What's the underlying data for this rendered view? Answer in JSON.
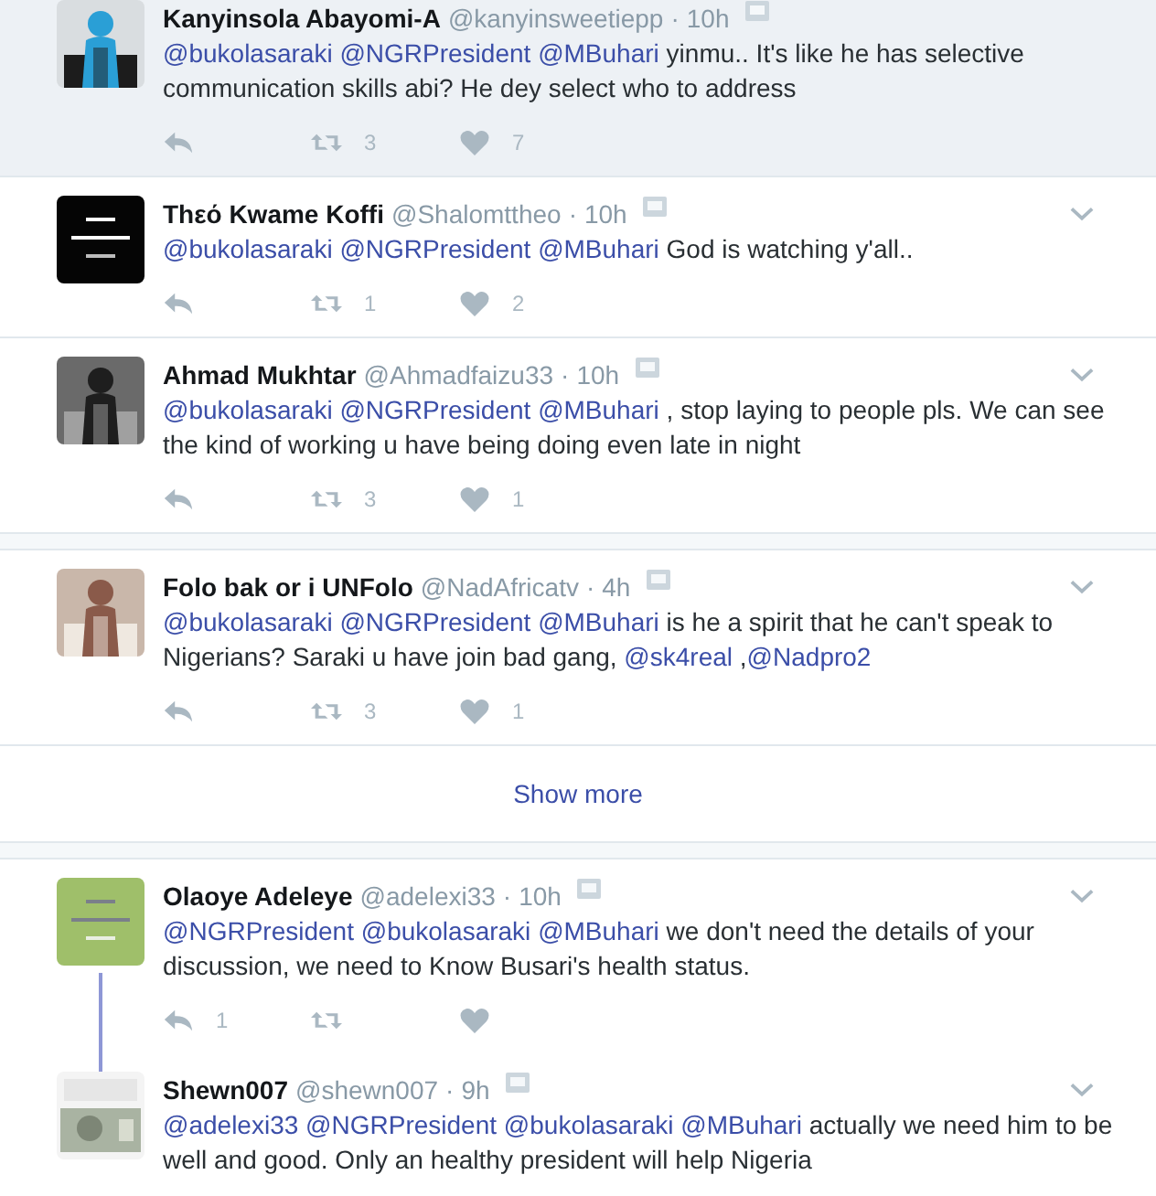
{
  "groups": [
    {
      "tweets": [
        {
          "name": "Kanyinsola Abayomi-A",
          "handle": "@kanyinsweetiepp",
          "dot": "·",
          "time": "10h",
          "cut_top": true,
          "highlighted": true,
          "thread": false,
          "actions": true,
          "text": [
            {
              "kind": "mention",
              "text": "@bukolasaraki"
            },
            {
              "kind": "mention",
              "text": "@NGRPresident"
            },
            {
              "kind": "mention",
              "text": "@MBuhari"
            },
            {
              "kind": "text",
              "text": "yinmu.. It's like he has selective communication skills abi? He dey select who to address"
            }
          ],
          "retweets": "3",
          "likes": "7"
        },
        {
          "name": "Thεό Kwame Koffi",
          "handle": "@Shalomttheo",
          "dot": "·",
          "time": "10h",
          "cut_top": false,
          "highlighted": false,
          "thread": false,
          "actions": true,
          "text": [
            {
              "kind": "mention",
              "text": "@bukolasaraki"
            },
            {
              "kind": "mention",
              "text": "@NGRPresident"
            },
            {
              "kind": "mention",
              "text": "@MBuhari"
            },
            {
              "kind": "text",
              "text": "God is watching y'all.."
            }
          ],
          "retweets": "1",
          "likes": "2"
        },
        {
          "name": "Ahmad Mukhtar",
          "handle": "@Ahmadfaizu33",
          "dot": "·",
          "time": "10h",
          "cut_top": false,
          "highlighted": false,
          "thread": false,
          "actions": true,
          "text": [
            {
              "kind": "mention",
              "text": "@bukolasaraki"
            },
            {
              "kind": "mention",
              "text": "@NGRPresident"
            },
            {
              "kind": "mention",
              "text": "@MBuhari"
            },
            {
              "kind": "text",
              "text": ", stop laying to people pls. We can see the kind of working u have being doing even late in night"
            }
          ],
          "retweets": "3",
          "likes": "1"
        }
      ]
    },
    {
      "tweets": [
        {
          "name": "Folo bak or i UNFolo",
          "handle": "@NadAfricatv",
          "dot": "·",
          "time": "4h",
          "cut_top": false,
          "highlighted": false,
          "thread": false,
          "actions": true,
          "text": [
            {
              "kind": "mention",
              "text": "@bukolasaraki"
            },
            {
              "kind": "mention",
              "text": "@NGRPresident"
            },
            {
              "kind": "mention",
              "text": "@MBuhari"
            },
            {
              "kind": "text",
              "text": "is he a spirit that he can't speak to Nigerians? Saraki u have join bad gang,"
            },
            {
              "kind": "mention",
              "text": "@sk4real"
            },
            {
              "kind": "text",
              "text": ","
            },
            {
              "kind": "mention",
              "text": "@Nadpro2",
              "attached": true
            }
          ],
          "retweets": "3",
          "likes": "1"
        }
      ],
      "show_more": "Show more"
    },
    {
      "tweets": [
        {
          "name": "Olaoye Adeleye",
          "handle": "@adelexi33",
          "dot": "·",
          "time": "10h",
          "cut_top": false,
          "highlighted": false,
          "thread": true,
          "actions": true,
          "text": [
            {
              "kind": "mention",
              "text": "@NGRPresident"
            },
            {
              "kind": "mention",
              "text": "@bukolasaraki"
            },
            {
              "kind": "mention",
              "text": "@MBuhari"
            },
            {
              "kind": "text",
              "text": "we don't need the details of your discussion,  we need to Know Busari's health status."
            }
          ],
          "replies": "1"
        },
        {
          "name": "Shewn007",
          "handle": "@shewn007",
          "dot": "·",
          "time": "9h",
          "cut_top": false,
          "highlighted": false,
          "thread": false,
          "actions": false,
          "text": [
            {
              "kind": "mention",
              "text": "@adelexi33"
            },
            {
              "kind": "mention",
              "text": "@NGRPresident"
            },
            {
              "kind": "mention",
              "text": "@bukolasaraki"
            },
            {
              "kind": "mention",
              "text": "@MBuhari"
            },
            {
              "kind": "text",
              "text": "actually we need him to be well and good. Only an healthy president will help Nigeria"
            }
          ]
        }
      ]
    }
  ]
}
